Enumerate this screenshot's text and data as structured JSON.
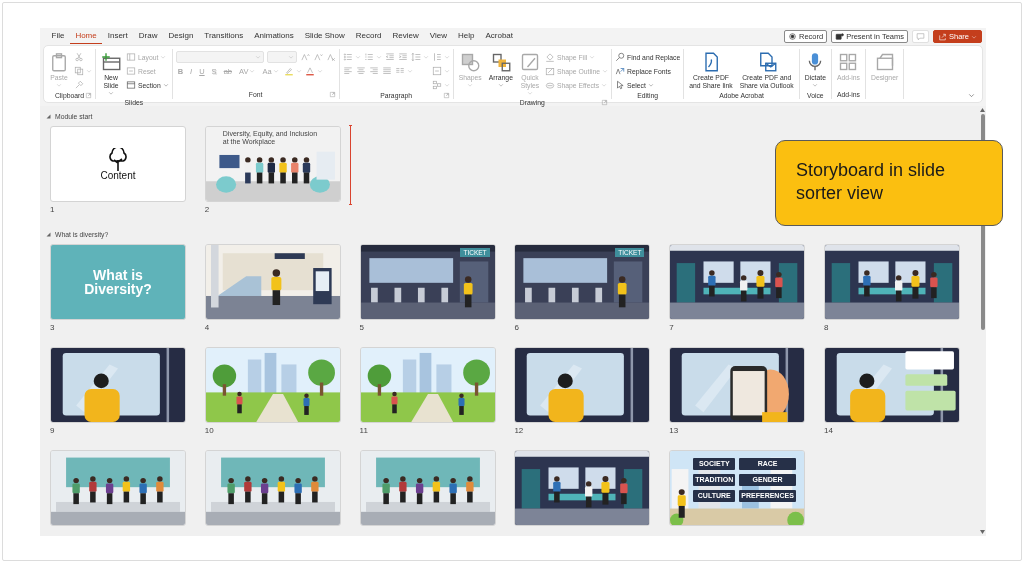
{
  "tabs": [
    {
      "label": "File",
      "selected": false
    },
    {
      "label": "Home",
      "selected": true
    },
    {
      "label": "Insert",
      "selected": false
    },
    {
      "label": "Draw",
      "selected": false
    },
    {
      "label": "Design",
      "selected": false
    },
    {
      "label": "Transitions",
      "selected": false
    },
    {
      "label": "Animations",
      "selected": false
    },
    {
      "label": "Slide Show",
      "selected": false
    },
    {
      "label": "Record",
      "selected": false
    },
    {
      "label": "Review",
      "selected": false
    },
    {
      "label": "View",
      "selected": false
    },
    {
      "label": "Help",
      "selected": false
    },
    {
      "label": "Acrobat",
      "selected": false
    }
  ],
  "header_buttons": [
    {
      "kind": "record",
      "label": "Record",
      "disabled": false
    },
    {
      "kind": "teams",
      "label": "Present in Teams",
      "disabled": false
    },
    {
      "kind": "comment",
      "disabled": true
    },
    {
      "kind": "share",
      "label": "Share",
      "disabled": false
    }
  ],
  "ribbon": {
    "groups": [
      {
        "label": "Clipboard",
        "items": [
          {
            "kind": "large",
            "label": "Paste",
            "disabled": true
          },
          {
            "kind": "rows",
            "rows": [
              [
                {
                  "kind": "icon",
                  "disabled": true
                }
              ],
              [
                {
                  "kind": "icon",
                  "disabled": true
                }
              ],
              [
                {
                  "kind": "icon",
                  "disabled": true
                }
              ]
            ]
          }
        ]
      },
      {
        "label": "Slides",
        "items": [
          {
            "kind": "large",
            "label": "New\nSlide",
            "disabled": false
          },
          {
            "kind": "rows",
            "rows": [
              [
                {
                  "kind": "icon",
                  "label": "Layout",
                  "disabled": true
                }
              ],
              [
                {
                  "kind": "icon",
                  "label": "Reset",
                  "disabled": true
                }
              ],
              [
                {
                  "kind": "icon",
                  "label": "Section",
                  "disabled": false
                }
              ]
            ]
          }
        ]
      },
      {
        "label": "Font",
        "items": [
          {
            "kind": "rows",
            "rows": [
              [
                {
                  "kind": "combo",
                  "disabled": true
                },
                {
                  "kind": "combo",
                  "disabled": true
                },
                {
                  "kind": "icon",
                  "disabled": true
                },
                {
                  "kind": "icon",
                  "disabled": true
                },
                {
                  "kind": "icon",
                  "disabled": true
                }
              ],
              [
                {
                  "kind": "glyph",
                  "glyph": "B",
                  "disabled": true
                },
                {
                  "kind": "glyph",
                  "glyph": "I",
                  "disabled": true
                },
                {
                  "kind": "glyph",
                  "glyph": "U",
                  "disabled": true
                },
                {
                  "kind": "glyph",
                  "glyph": "S",
                  "disabled": true
                },
                {
                  "kind": "glyph",
                  "glyph": "ab",
                  "disabled": true
                },
                {
                  "kind": "glyph",
                  "glyph": "AV",
                  "disabled": true
                },
                {
                  "kind": "glyph",
                  "glyph": "Aa",
                  "disabled": true
                },
                {
                  "kind": "icon",
                  "disabled": true
                },
                {
                  "kind": "icon",
                  "disabled": true
                }
              ]
            ]
          }
        ]
      },
      {
        "label": "Paragraph",
        "items": [
          {
            "kind": "rows",
            "rows": [
              [
                {
                  "kind": "icon",
                  "disabled": true
                },
                {
                  "kind": "icon",
                  "disabled": true
                },
                {
                  "kind": "icon",
                  "disabled": true
                },
                {
                  "kind": "icon",
                  "disabled": true
                },
                {
                  "kind": "icon",
                  "disabled": true
                }
              ],
              [
                {
                  "kind": "icon",
                  "disabled": true
                },
                {
                  "kind": "icon",
                  "disabled": true
                },
                {
                  "kind": "icon",
                  "disabled": true
                },
                {
                  "kind": "icon",
                  "disabled": true
                },
                {
                  "kind": "icon",
                  "disabled": true
                }
              ]
            ]
          },
          {
            "kind": "rows",
            "rows": [
              [
                {
                  "kind": "icon",
                  "disabled": true
                }
              ],
              [
                {
                  "kind": "icon",
                  "disabled": true
                }
              ],
              [
                {
                  "kind": "icon",
                  "disabled": true
                }
              ]
            ]
          }
        ]
      },
      {
        "label": "Drawing",
        "items": [
          {
            "kind": "large",
            "label": "Shapes",
            "disabled": true
          },
          {
            "kind": "large",
            "label": "Arrange",
            "disabled": false
          },
          {
            "kind": "large",
            "label": "Quick\nStyles",
            "disabled": true
          },
          {
            "kind": "rows",
            "rows": [
              [
                {
                  "kind": "icon",
                  "label": "Shape Fill",
                  "disabled": true
                }
              ],
              [
                {
                  "kind": "icon",
                  "label": "Shape Outline",
                  "disabled": true
                }
              ],
              [
                {
                  "kind": "icon",
                  "label": "Shape Effects",
                  "disabled": true
                }
              ]
            ]
          }
        ]
      },
      {
        "label": "Editing",
        "items": [
          {
            "kind": "rows",
            "rows": [
              [
                {
                  "kind": "icon",
                  "label": "Find and Replace",
                  "disabled": false
                }
              ],
              [
                {
                  "kind": "icon",
                  "label": "Replace Fonts",
                  "disabled": false
                }
              ],
              [
                {
                  "kind": "icon",
                  "label": "Select",
                  "disabled": false
                }
              ]
            ]
          }
        ]
      },
      {
        "label": "Adobe Acrobat",
        "items": [
          {
            "kind": "large",
            "label": "Create PDF\nand Share link",
            "disabled": false
          },
          {
            "kind": "large",
            "label": "Create PDF and\nShare via Outlook",
            "disabled": false
          }
        ]
      },
      {
        "label": "Voice",
        "items": [
          {
            "kind": "large",
            "label": "Dictate",
            "disabled": false
          }
        ]
      },
      {
        "label": "Add-ins",
        "items": [
          {
            "kind": "large",
            "label": "Add-ins",
            "disabled": true
          }
        ]
      },
      {
        "items": [
          {
            "kind": "large",
            "label": "Designer",
            "disabled": true
          }
        ]
      }
    ]
  },
  "sections": [
    {
      "title": "Module start",
      "expanded": true,
      "slides": [
        {
          "number": "1",
          "kind": "logo",
          "caption": "Content"
        },
        {
          "number": "2",
          "kind": "cover",
          "title": "Diversity, Equity, and Inclusion\nat the Workplace",
          "drop_marker": true
        }
      ]
    },
    {
      "title": "What is diversity?",
      "expanded": true,
      "slides": [
        {
          "number": "3",
          "kind": "title",
          "title": "What is Diversity?"
        },
        {
          "number": "4",
          "kind": "station"
        },
        {
          "number": "5",
          "kind": "gates",
          "sign": "TICKET"
        },
        {
          "number": "6",
          "kind": "gates",
          "sign": "TICKET"
        },
        {
          "number": "7",
          "kind": "train"
        },
        {
          "number": "8",
          "kind": "train"
        },
        {
          "number": "9",
          "kind": "window"
        },
        {
          "number": "10",
          "kind": "park"
        },
        {
          "number": "11",
          "kind": "park"
        },
        {
          "number": "12",
          "kind": "window"
        },
        {
          "number": "13",
          "kind": "phone"
        },
        {
          "number": "14",
          "kind": "chat"
        },
        {
          "kind": "office"
        },
        {
          "kind": "office"
        },
        {
          "kind": "office"
        },
        {
          "kind": "train"
        },
        {
          "kind": "city",
          "labels": [
            "SOCIETY",
            "RACE",
            "TRADITION",
            "GENDER",
            "CULTURE",
            "PREFERENCES"
          ]
        }
      ]
    }
  ],
  "callout": {
    "text": "Storyboard in slide sorter view"
  }
}
